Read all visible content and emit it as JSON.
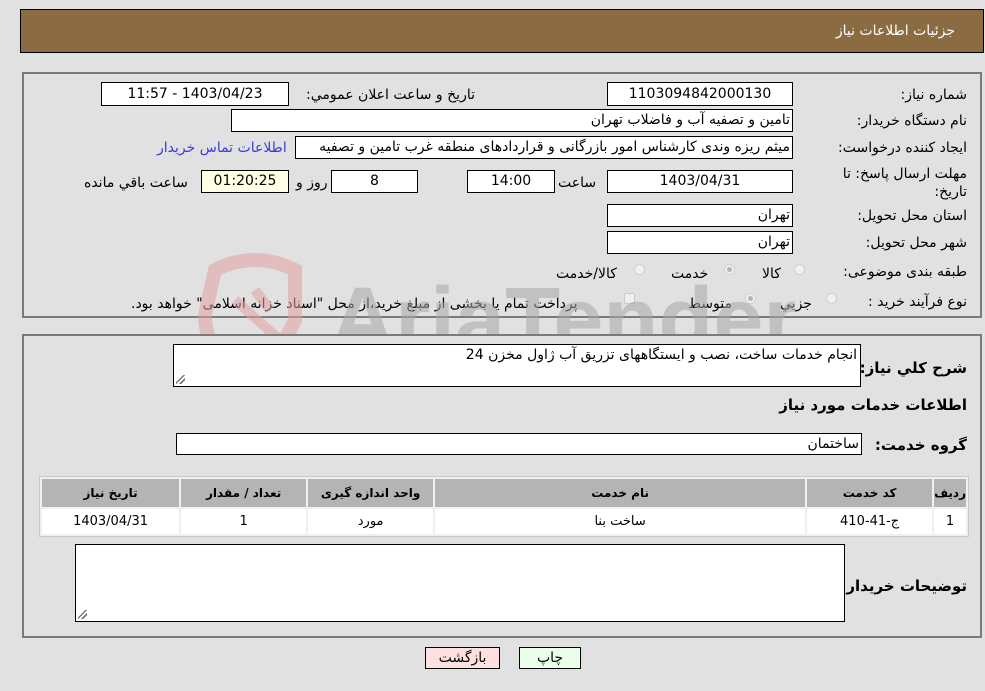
{
  "header": {
    "title": "جزئیات اطلاعات نیاز"
  },
  "form": {
    "need_number": {
      "label": "شماره نیاز:",
      "value": "1103094842000130"
    },
    "announce_datetime": {
      "label": "تاریخ و ساعت اعلان عمومي:",
      "value": "1403/04/23 - 11:57"
    },
    "buyer_org": {
      "label": "نام دستگاه خريدار:",
      "value": "تامین و تصفیه آب و فاضلاب تهران"
    },
    "requester": {
      "label": "ايجاد کننده درخواست:",
      "value": "میثم ریزه وندی کارشناس امور بازرگانی و قراردادهای منطقه غرب تامین و تصفیه"
    },
    "buyer_contact_link": "اطلاعات تماس خريدار",
    "deadline": {
      "label": "مهلت ارسال پاسخ: تا تاريخ:",
      "date": "1403/04/31",
      "time_label": "ساعت",
      "time": "14:00",
      "days": "8",
      "days_label": "روز و",
      "remaining": "01:20:25",
      "remaining_label": "ساعت باقي مانده"
    },
    "province": {
      "label": "استان محل تحويل:",
      "value": "تهران"
    },
    "city": {
      "label": "شهر محل تحويل:",
      "value": "تهران"
    },
    "category": {
      "label": "طبقه بندی موضوعی:",
      "options": [
        {
          "label": "کالا",
          "checked": false
        },
        {
          "label": "خدمت",
          "checked": true
        },
        {
          "label": "کالا/خدمت",
          "checked": false
        }
      ]
    },
    "purchase_type": {
      "label": "نوع فرآيند خريد :",
      "options": [
        {
          "label": "جزيي",
          "checked": false
        },
        {
          "label": "متوسط",
          "checked": true
        }
      ],
      "treasury_checkbox_label": "پرداخت تمام يا بخشی از مبلغ خريد،از محل \"اسناد خزانه اسلامی\" خواهد بود.",
      "treasury_checked": false
    }
  },
  "details": {
    "general_desc_label": "شرح کلي نياز:",
    "general_desc_value": "انجام خدمات ساخت، نصب و ایستگاههای تزریق آب ژاول مخزن 24",
    "services_section_title": "اطلاعات خدمات مورد نياز",
    "service_group_label": "گروه خدمت:",
    "service_group_value": "ساختمان",
    "table": {
      "headers": [
        "رديف",
        "کد خدمت",
        "نام خدمت",
        "واحد اندازه گيری",
        "تعداد / مقدار",
        "تاريخ نياز"
      ],
      "rows": [
        [
          "1",
          "ج-41-410",
          "ساخت بنا",
          "مورد",
          "1",
          "1403/04/31"
        ]
      ]
    },
    "buyer_notes_label": "توضيحات خريدار:",
    "buyer_notes_value": ""
  },
  "buttons": {
    "print": "چاپ",
    "back": "بازگشت"
  },
  "colors": {
    "header_bg": "#8b6c42",
    "print_bg": "#eaffea",
    "back_bg": "#ffe0e0",
    "link": "#3a3adb",
    "table_header_bg": "#b4b4b4",
    "remaining_bg": "#ffffe6"
  },
  "watermark": {
    "text": "AriaTender.neT"
  }
}
